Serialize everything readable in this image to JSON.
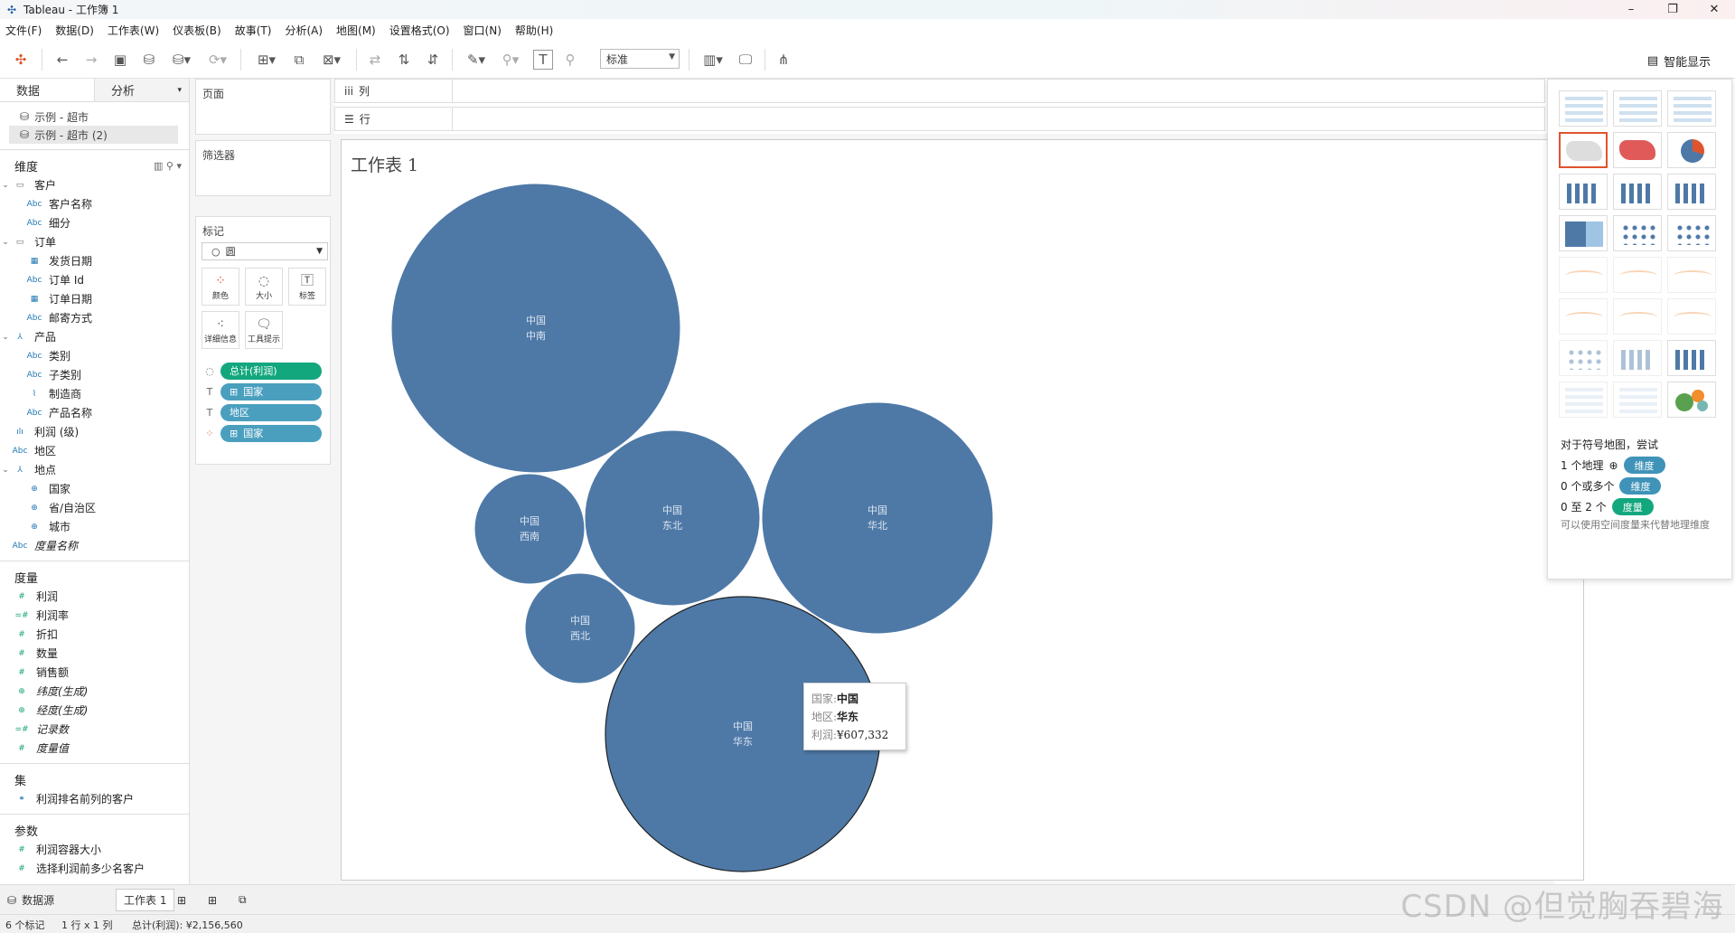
{
  "app": {
    "title": "Tableau - 工作簿 1"
  },
  "menu": [
    "文件(F)",
    "数据(D)",
    "工作表(W)",
    "仪表板(B)",
    "故事(T)",
    "分析(A)",
    "地图(M)",
    "设置格式(O)",
    "窗口(N)",
    "帮助(H)"
  ],
  "toolbar": {
    "fit_select": "标准",
    "smart_show_label": "智能显示"
  },
  "data_pane": {
    "tab_data": "数据",
    "tab_analysis": "分析",
    "sources": [
      "示例 - 超市",
      "示例 - 超市 (2)"
    ],
    "dimensions_header": "维度",
    "dimension_folders": [
      {
        "name": "客户",
        "fields": [
          "客户名称",
          "细分"
        ]
      },
      {
        "name": "订单",
        "fields": [
          "发货日期",
          "订单 Id",
          "订单日期",
          "邮寄方式"
        ]
      },
      {
        "name": "产品",
        "fields": [
          "类别",
          "子类别",
          "制造商",
          "产品名称"
        ]
      }
    ],
    "loose_dims": [
      "利润 (级)",
      "地区"
    ],
    "location_folder": {
      "name": "地点",
      "fields": [
        "国家",
        "省/自治区",
        "城市"
      ]
    },
    "measure_names": "度量名称",
    "measures_header": "度量",
    "measures": [
      "利润",
      "利润率",
      "折扣",
      "数量",
      "销售额",
      "纬度(生成)",
      "经度(生成)",
      "记录数",
      "度量值"
    ],
    "sets_header": "集",
    "sets": [
      "利润排名前列的客户"
    ],
    "params_header": "参数",
    "params": [
      "利润容器大小",
      "选择利润前多少名客户"
    ]
  },
  "cards": {
    "pages": "页面",
    "filters": "筛选器",
    "marks": "标记",
    "mark_type": "圆",
    "mark_buttons": [
      "颜色",
      "大小",
      "标签",
      "详细信息",
      "工具提示"
    ],
    "mark_pills": [
      "总计(利润)",
      "国家",
      "地区",
      "国家"
    ]
  },
  "shelves": {
    "columns": "列",
    "rows": "行"
  },
  "sheet": {
    "title": "工作表 1"
  },
  "chart_data": {
    "type": "packed-bubbles",
    "size_measure": "总计(利润)",
    "total_profit": "¥2,156,560",
    "bubbles": [
      {
        "country": "中国",
        "region": "中南",
        "profit": null
      },
      {
        "country": "中国",
        "region": "西南",
        "profit": null
      },
      {
        "country": "中国",
        "region": "东北",
        "profit": null
      },
      {
        "country": "中国",
        "region": "华北",
        "profit": null
      },
      {
        "country": "中国",
        "region": "西北",
        "profit": null
      },
      {
        "country": "中国",
        "region": "华东",
        "profit": 607332
      }
    ],
    "color": "#4e79a7"
  },
  "tooltip": {
    "k1": "国家:",
    "v1": "中国",
    "k2": "地区:",
    "v2": "华东",
    "k3": "利润:",
    "v3": "¥607,332"
  },
  "smart_show": {
    "hint_title": "对于符号地图，尝试",
    "req1_prefix": "1 个地理",
    "req1_pill": "维度",
    "req2_prefix": "0 个或多个",
    "req2_pill": "维度",
    "req3_prefix": "0 至 2 个",
    "req3_pill": "度量",
    "note": "可以使用空间度量来代替地理维度"
  },
  "tabs": {
    "datasource": "数据源",
    "sheet": "工作表 1"
  },
  "status": {
    "marks": "6 个标记",
    "dims": "1 行 x 1 列",
    "sum": "总计(利润): ¥2,156,560"
  },
  "watermark": "CSDN @但觉胸吞碧海"
}
